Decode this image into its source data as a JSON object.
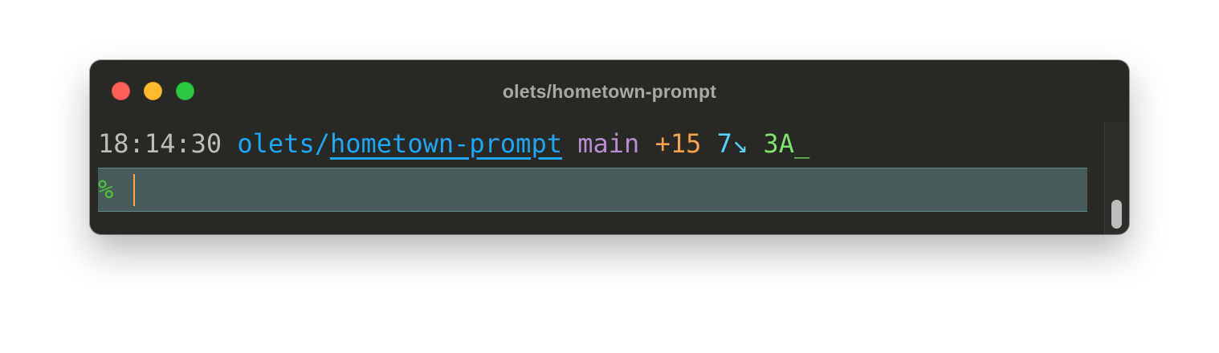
{
  "window": {
    "title": "olets/hometown-prompt"
  },
  "terminal": {
    "prompt_line": {
      "time": "18:14:30",
      "repo_owner": "olets/",
      "repo_name": "hometown-prompt",
      "branch": "main",
      "added": "+15",
      "behind": "7↘",
      "ahead": "3A_"
    },
    "input": {
      "prompt_symbol": "%",
      "value": ""
    }
  },
  "colors": {
    "background": "#282825",
    "time": "#bdbdb8",
    "repo": "#1ea7f3",
    "branch": "#b88dd2",
    "added": "#f4a44e",
    "behind": "#5ad0f4",
    "ahead": "#7fe26a",
    "prompt_symbol": "#4cc53c",
    "cursor": "#f4a44e",
    "input_highlight": "#495a5b"
  }
}
